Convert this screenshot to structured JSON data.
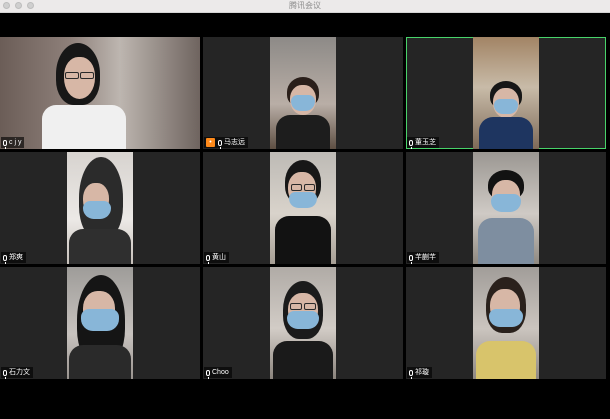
{
  "window": {
    "title": "腾讯会议"
  },
  "participants": [
    {
      "name": "c j y",
      "active": false,
      "badge": false
    },
    {
      "name": "马志远",
      "active": false,
      "badge": true
    },
    {
      "name": "董玉芝",
      "active": true,
      "badge": false
    },
    {
      "name": "郑爽",
      "active": false,
      "badge": false
    },
    {
      "name": "黄山",
      "active": false,
      "badge": false
    },
    {
      "name": "芊蒯芊",
      "active": false,
      "badge": false
    },
    {
      "name": "石力文",
      "active": false,
      "badge": false
    },
    {
      "name": "Choo",
      "active": false,
      "badge": false
    },
    {
      "name": "祁璇",
      "active": false,
      "badge": false
    }
  ],
  "colors": {
    "active_border": "#48d36a",
    "badge": "#ff8a1a",
    "mask": "#88b6d8"
  },
  "icons": {
    "mic": "microphone-icon",
    "avatar": "person-icon"
  }
}
